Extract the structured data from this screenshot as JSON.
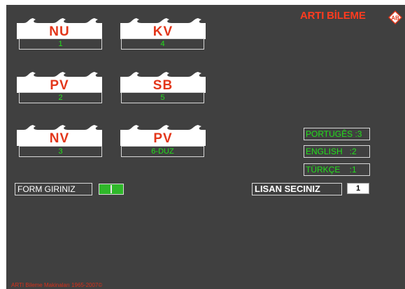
{
  "brand": {
    "name": "ARTI BİLEME",
    "logo_text": "AB"
  },
  "blades": [
    {
      "label": "NU",
      "code": "1"
    },
    {
      "label": "KV",
      "code": "4"
    },
    {
      "label": "PV",
      "code": "2"
    },
    {
      "label": "SB",
      "code": "5"
    },
    {
      "label": "NV",
      "code": "3"
    },
    {
      "label": "PV",
      "code": "6-DUZ"
    }
  ],
  "languages": [
    {
      "label": "PORTUGÊS :3"
    },
    {
      "label": "ENGLISH   :2"
    },
    {
      "label": "TÜRKÇE    :1"
    }
  ],
  "form": {
    "label": "FORM GIRINIZ"
  },
  "language_select": {
    "label": "LISAN SECINIZ",
    "value": "1"
  },
  "footer": {
    "copyright": "ARTI Bileme Makinaları 1965-2007©"
  },
  "colors": {
    "panel": "#404040",
    "accent_red": "#e3361a",
    "accent_green": "#22e01a"
  }
}
